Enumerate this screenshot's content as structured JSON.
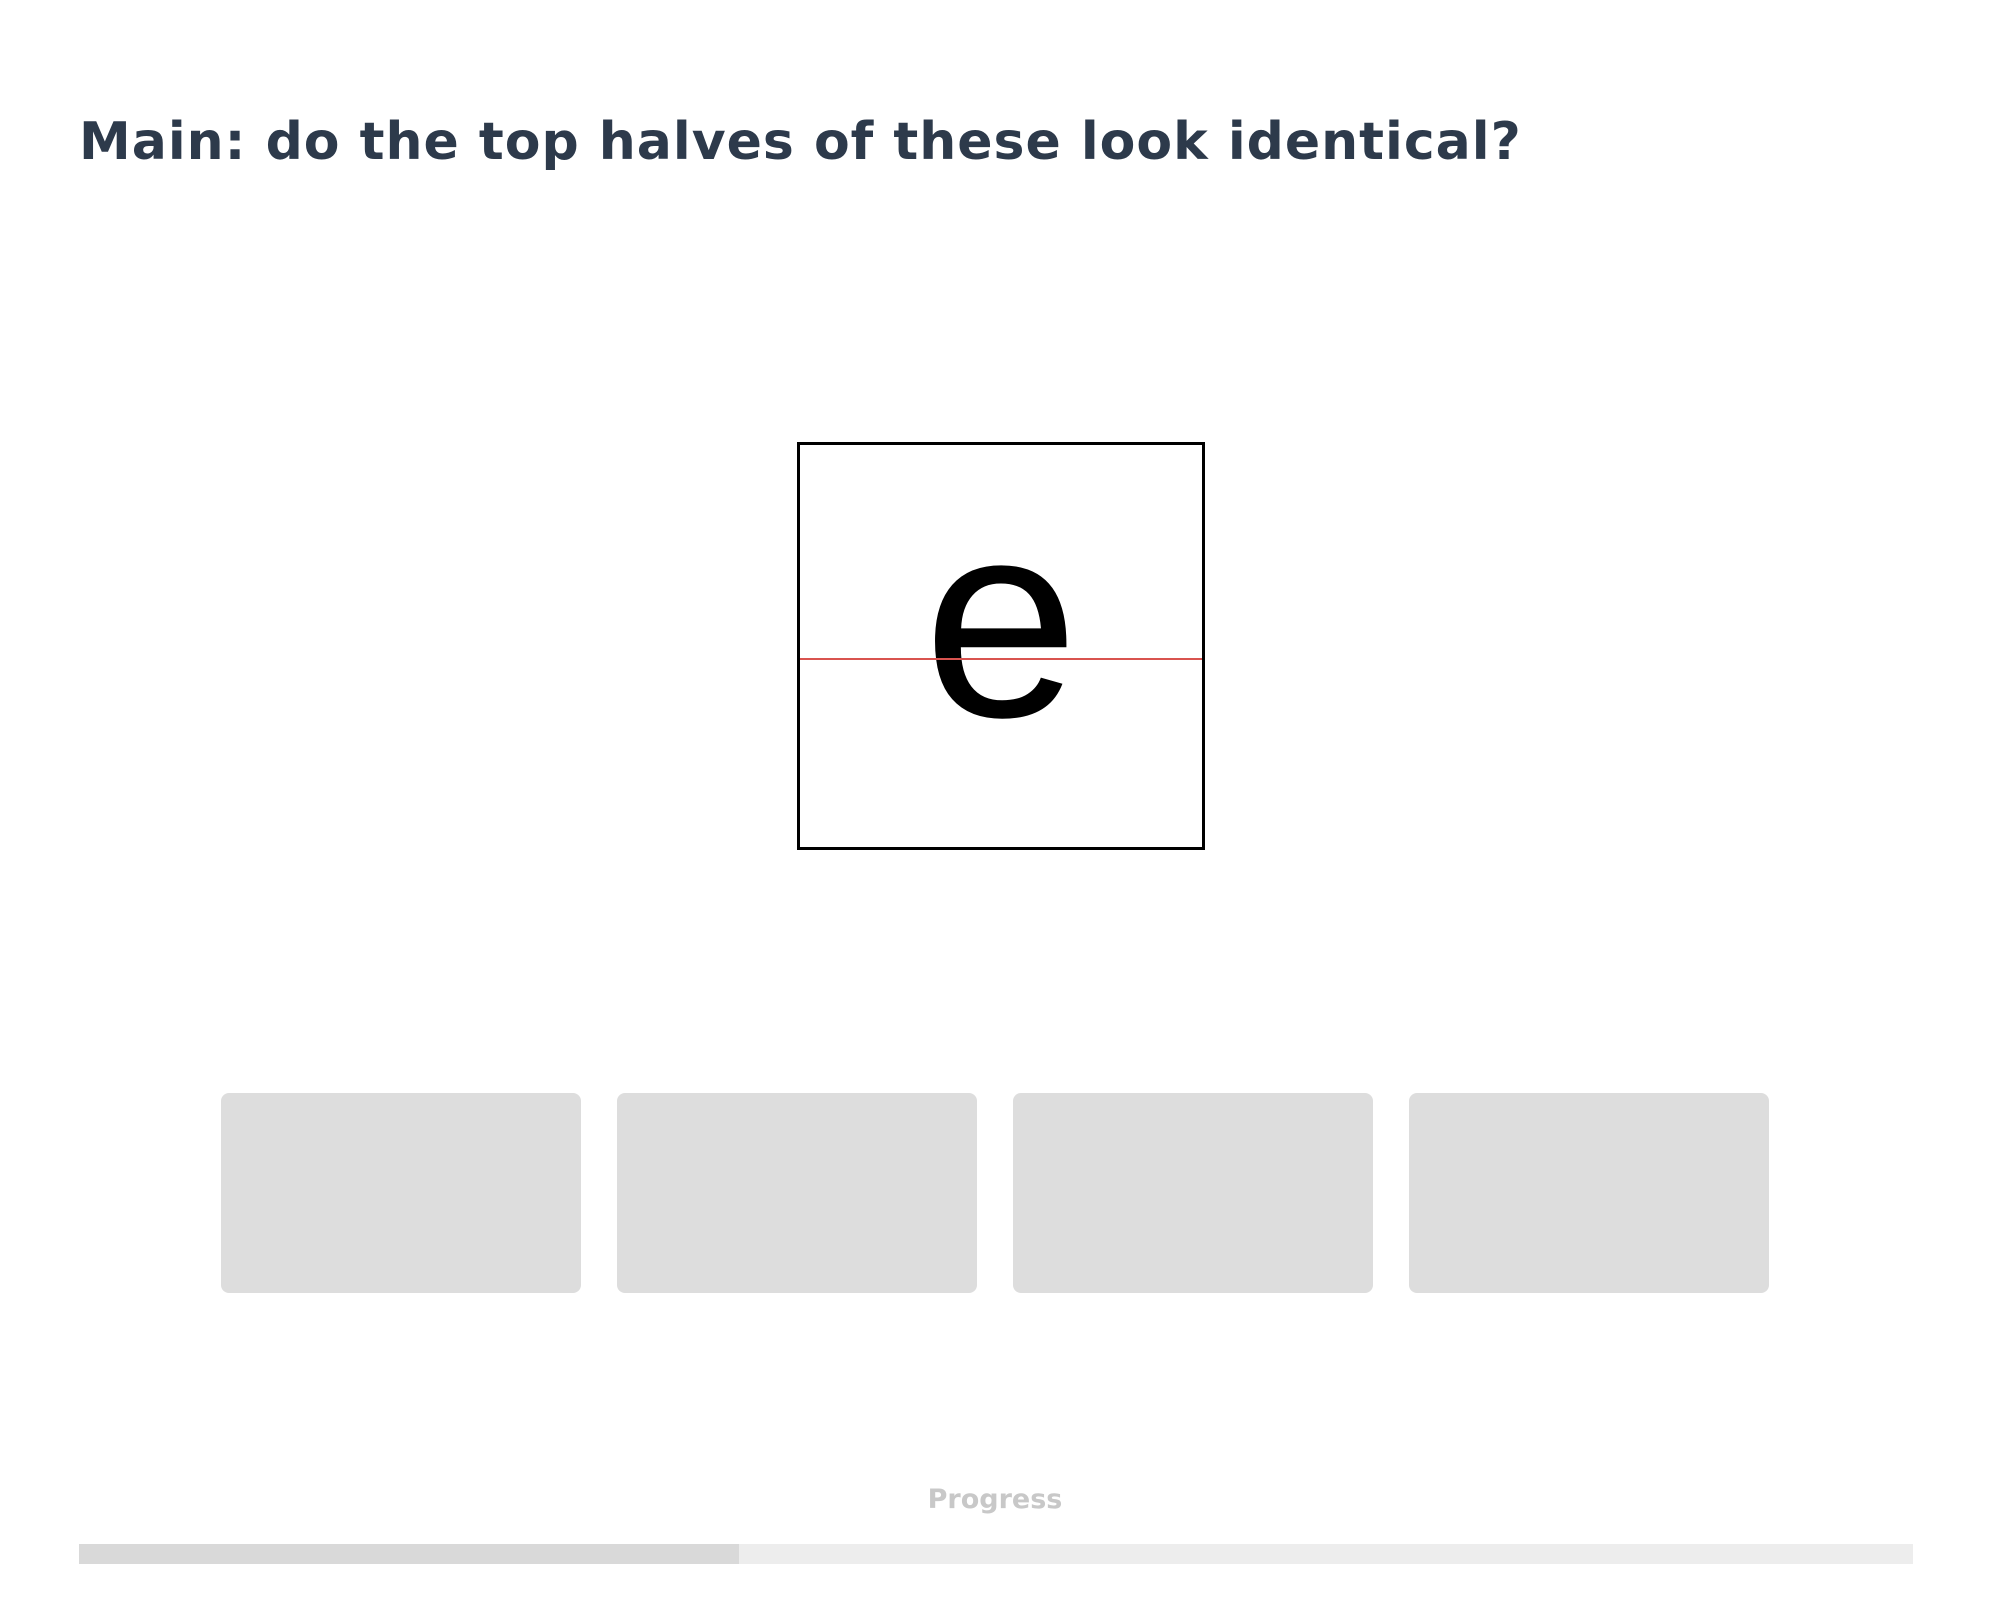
{
  "question": "Main: do the top halves of these look identical?",
  "stimulus": {
    "glyph": "e",
    "midline_color": "#d9534f"
  },
  "choices": [
    {
      "label": ""
    },
    {
      "label": ""
    },
    {
      "label": ""
    },
    {
      "label": ""
    }
  ],
  "progress": {
    "label": "Progress",
    "fraction": 0.36
  },
  "colors": {
    "title": "#2d3a4b",
    "choice_bg": "#dddddd",
    "progress_track": "#ededed",
    "progress_fill": "#d9d9d9"
  }
}
